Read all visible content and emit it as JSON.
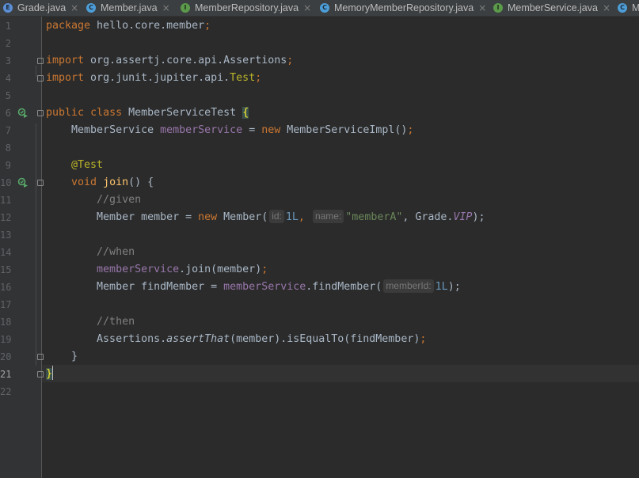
{
  "tabs": [
    {
      "label": "Grade.java",
      "icon": "E",
      "icon_color": "#5a8fd6"
    },
    {
      "label": "Member.java",
      "icon": "C",
      "icon_color": "#4d9ed8"
    },
    {
      "label": "MemberRepository.java",
      "icon": "I",
      "icon_color": "#5b9a4a"
    },
    {
      "label": "MemoryMemberRepository.java",
      "icon": "C",
      "icon_color": "#4d9ed8"
    },
    {
      "label": "MemberService.java",
      "icon": "I",
      "icon_color": "#5b9a4a"
    },
    {
      "label": "M",
      "icon": "C",
      "icon_color": "#4d9ed8"
    }
  ],
  "tab_close_glyph": "×",
  "line_numbers": [
    "1",
    "2",
    "3",
    "4",
    "5",
    "6",
    "7",
    "8",
    "9",
    "10",
    "11",
    "12",
    "13",
    "14",
    "15",
    "16",
    "17",
    "18",
    "19",
    "20",
    "21",
    "22"
  ],
  "code": {
    "l1": {
      "kw": "package",
      "pkg": " hello.core.member",
      "semi": ";"
    },
    "l3": {
      "kw": "import",
      "pkg": " org.assertj.core.api.Assertions",
      "semi": ";"
    },
    "l4": {
      "kw": "import",
      "pkg": " org.junit.jupiter.api.",
      "cls": "Test",
      "semi": ";"
    },
    "l6": {
      "kw1": "public",
      "kw2": "class",
      "name": " MemberServiceTest ",
      "brace": "{"
    },
    "l7": {
      "indent": "    ",
      "type": "MemberService ",
      "field": "memberService",
      "eq": " = ",
      "kw": "new",
      "rest": " MemberServiceImpl()",
      "semi": ";"
    },
    "l9": {
      "indent": "    ",
      "anno": "@Test"
    },
    "l10": {
      "indent": "    ",
      "kw": "void",
      "method": "join",
      "rest": "() {"
    },
    "l11": {
      "indent": "        ",
      "comment": "//given"
    },
    "l12": {
      "indent": "        ",
      "a": "Member member = ",
      "kw": "new",
      "b": " Member(",
      "hint1": "id:",
      "num": "1L",
      "comma1": ", ",
      "hint2": "name:",
      "str": "\"memberA\"",
      "comma2": ", Grade.",
      "vip": "VIP",
      "end": ");"
    },
    "l14": {
      "indent": "        ",
      "comment": "//when"
    },
    "l15": {
      "indent": "        ",
      "field": "memberService",
      "rest": ".join(member)",
      "semi": ";"
    },
    "l16": {
      "indent": "        ",
      "a": "Member findMember = ",
      "field": "memberService",
      "b": ".findMember(",
      "hint": "memberId:",
      "num": "1L",
      "end": ");"
    },
    "l18": {
      "indent": "        ",
      "comment": "//then"
    },
    "l19": {
      "indent": "        ",
      "cls": "Assertions.",
      "static": "assertThat",
      "rest": "(member).isEqualTo(findMember)",
      "semi": ";"
    },
    "l20": {
      "indent": "    ",
      "brace": "}"
    },
    "l21": {
      "brace": "}"
    }
  }
}
